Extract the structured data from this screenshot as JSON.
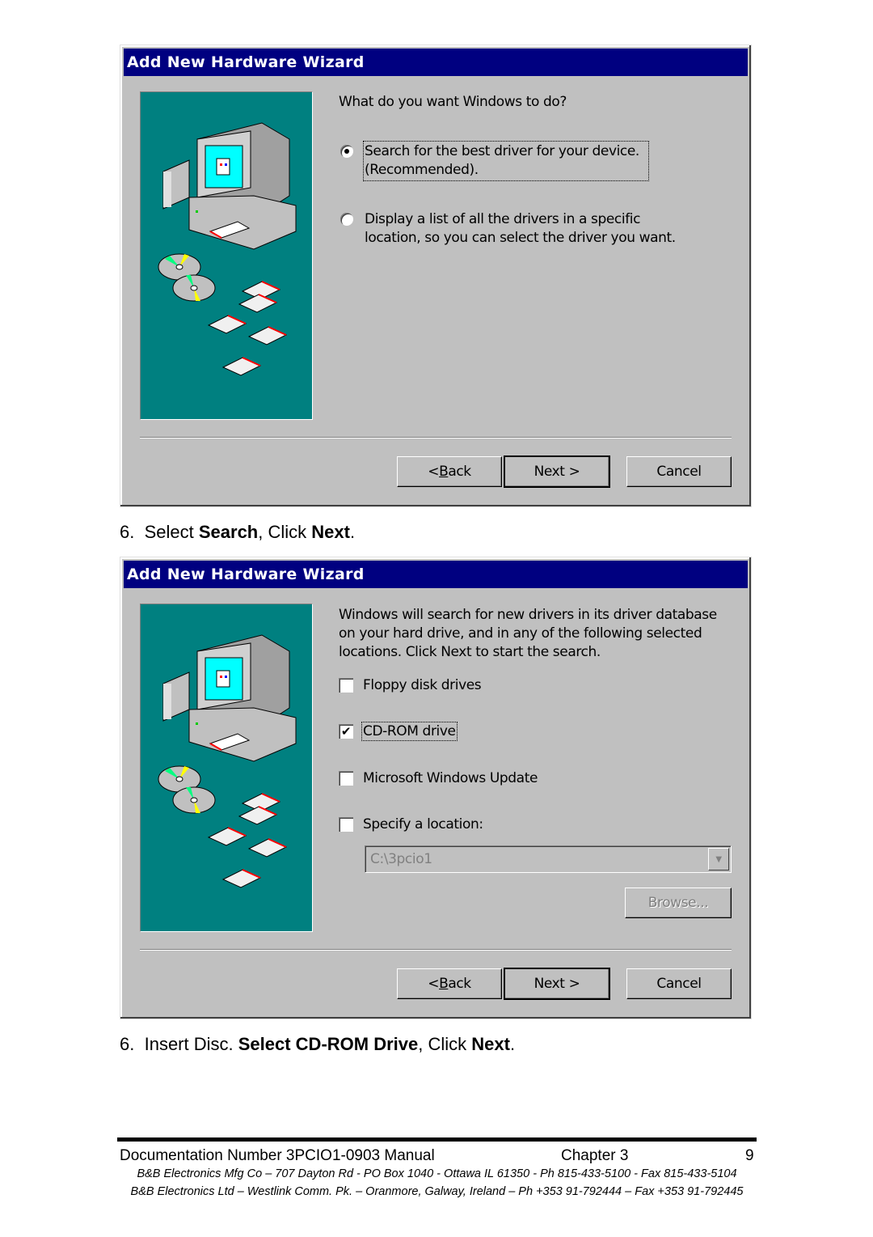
{
  "dialog1": {
    "title": "Add New Hardware Wizard",
    "prompt": "What do you want Windows to do?",
    "options": [
      {
        "label_line1": "Search for the best driver for your device.",
        "label_line2": "(Recommended).",
        "selected": true
      },
      {
        "label_line1": "Display a list of all the drivers in a specific",
        "label_line2": "location, so you can select the driver you want.",
        "selected": false
      }
    ],
    "buttons": {
      "back": "< ",
      "back_key": "B",
      "back_rest": "ack",
      "next": "Next >",
      "cancel": "Cancel"
    }
  },
  "caption1": {
    "num": "6.",
    "pre": "Select ",
    "bold1": "Search",
    "mid": ", Click ",
    "bold2": "Next",
    "post": "."
  },
  "dialog2": {
    "title": "Add New Hardware Wizard",
    "description": "Windows will search for new drivers in its driver database on your hard drive, and in any of the following selected locations. Click Next to start the search.",
    "checkboxes": [
      {
        "label": "Floppy disk drives",
        "checked": false
      },
      {
        "label": "CD-ROM drive",
        "checked": true
      },
      {
        "label": "Microsoft Windows Update",
        "checked": false
      },
      {
        "label": "Specify a location:",
        "checked": false
      }
    ],
    "location_value": "C:\\3pcio1",
    "browse_label": "Browse...",
    "buttons": {
      "back": "< ",
      "back_key": "B",
      "back_rest": "ack",
      "next": "Next >",
      "cancel": "Cancel"
    }
  },
  "caption2": {
    "num": "6.",
    "pre": "Insert Disc.  ",
    "bold1": "Select CD-ROM Drive",
    "mid": ", Click ",
    "bold2": "Next",
    "post": "."
  },
  "footer": {
    "doc_number": "Documentation Number 3PCIO1-0903 Manual",
    "chapter": "Chapter 3",
    "page": "9",
    "line1": "B&B Electronics Mfg Co – 707 Dayton Rd - PO Box 1040 - Ottawa IL 61350 - Ph 815-433-5100 - Fax 815-433-5104",
    "line2": "B&B Electronics Ltd – Westlink Comm. Pk. – Oranmore, Galway, Ireland – Ph +353 91-792444 – Fax +353 91-792445"
  },
  "icons": {
    "checkmark": "✔",
    "dropdown": "▼"
  }
}
